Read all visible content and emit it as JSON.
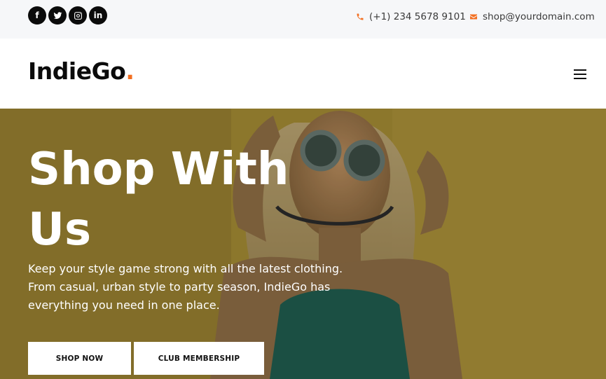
{
  "topbar": {
    "socials": [
      {
        "icon": "facebook-icon",
        "glyph": "f"
      },
      {
        "icon": "twitter-icon",
        "glyph": ""
      },
      {
        "icon": "instagram-icon",
        "glyph": ""
      },
      {
        "icon": "linkedin-icon",
        "glyph": "in"
      }
    ],
    "phone": "(+1) 234 5678 9101",
    "email": "shop@yourdomain.com",
    "accent_color": "#f36f21"
  },
  "navbar": {
    "logo_text": "IndieGo",
    "logo_dot": ".",
    "menu_icon": "hamburger-menu-icon"
  },
  "hero": {
    "title": "Shop With Us",
    "text": "Keep your style game strong with all the latest clothing. From casual, urban style to party season, IndieGo has everything you need in one place.",
    "buttons": {
      "shop": "SHOP NOW",
      "club": "CLUB MEMBERSHIP"
    }
  }
}
